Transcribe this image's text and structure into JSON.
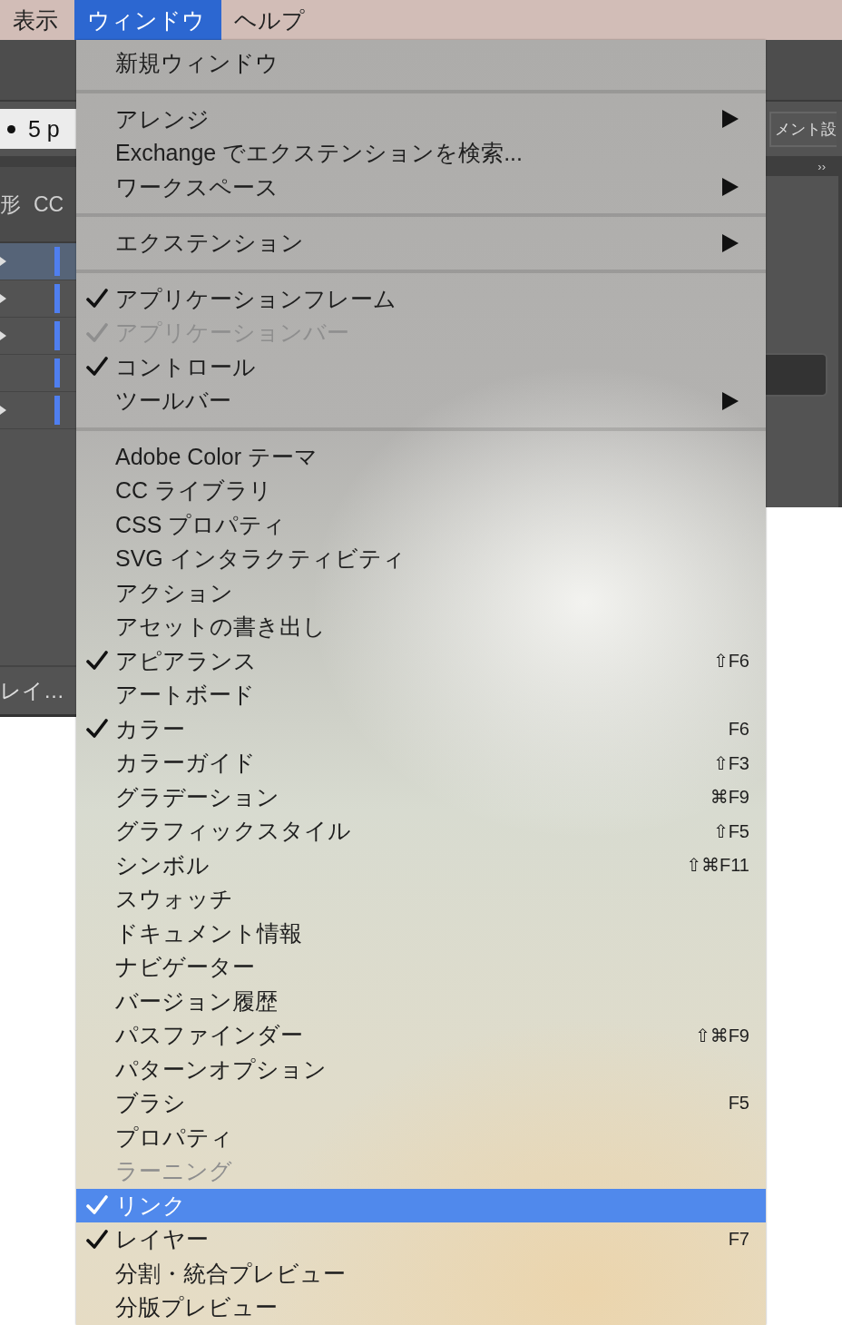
{
  "menu_bar": {
    "items": [
      {
        "label": "表示",
        "selected": false
      },
      {
        "label": "ウィンドウ",
        "selected": true
      },
      {
        "label": "ヘルプ",
        "selected": false
      }
    ]
  },
  "background": {
    "left_panel": {
      "size_field": "5 p",
      "tabs": [
        "形",
        "CC"
      ],
      "layer_rows": [
        {
          "selected": true,
          "expandable": true,
          "color": "#4f7ff0"
        },
        {
          "selected": false,
          "expandable": true,
          "color": "#4f7ff0"
        },
        {
          "selected": false,
          "expandable": true,
          "color": "#4f7ff0"
        },
        {
          "selected": false,
          "expandable": false,
          "color": "#4f7ff0"
        },
        {
          "selected": false,
          "expandable": true,
          "color": "#4f7ff0"
        }
      ],
      "footer": "レイ…"
    },
    "right_panel": {
      "button_label": "メント設",
      "collapse": "››"
    }
  },
  "menu": {
    "groups": [
      [
        {
          "label": "新規ウィンドウ",
          "checked": false,
          "disabled": false,
          "selected": false,
          "submenu": false
        }
      ],
      [
        {
          "label": "アレンジ",
          "checked": false,
          "disabled": false,
          "selected": false,
          "submenu": true
        },
        {
          "label": "Exchange でエクステンションを検索...",
          "checked": false,
          "disabled": false,
          "selected": false,
          "submenu": false
        },
        {
          "label": "ワークスペース",
          "checked": false,
          "disabled": false,
          "selected": false,
          "submenu": true
        }
      ],
      [
        {
          "label": "エクステンション",
          "checked": false,
          "disabled": false,
          "selected": false,
          "submenu": true
        }
      ],
      [
        {
          "label": "アプリケーションフレーム",
          "checked": true,
          "disabled": false,
          "selected": false,
          "submenu": false
        },
        {
          "label": "アプリケーションバー",
          "checked": true,
          "disabled": true,
          "selected": false,
          "submenu": false
        },
        {
          "label": "コントロール",
          "checked": true,
          "disabled": false,
          "selected": false,
          "submenu": false
        },
        {
          "label": "ツールバー",
          "checked": false,
          "disabled": false,
          "selected": false,
          "submenu": true
        }
      ],
      [
        {
          "label": "Adobe Color テーマ",
          "checked": false,
          "disabled": false,
          "selected": false,
          "submenu": false
        },
        {
          "label": "CC ライブラリ",
          "checked": false,
          "disabled": false,
          "selected": false,
          "submenu": false
        },
        {
          "label": "CSS プロパティ",
          "checked": false,
          "disabled": false,
          "selected": false,
          "submenu": false
        },
        {
          "label": "SVG インタラクティビティ",
          "checked": false,
          "disabled": false,
          "selected": false,
          "submenu": false
        },
        {
          "label": "アクション",
          "checked": false,
          "disabled": false,
          "selected": false,
          "submenu": false
        },
        {
          "label": "アセットの書き出し",
          "checked": false,
          "disabled": false,
          "selected": false,
          "submenu": false
        },
        {
          "label": "アピアランス",
          "checked": true,
          "disabled": false,
          "selected": false,
          "submenu": false,
          "shortcut": "⇧F6"
        },
        {
          "label": "アートボード",
          "checked": false,
          "disabled": false,
          "selected": false,
          "submenu": false
        },
        {
          "label": "カラー",
          "checked": true,
          "disabled": false,
          "selected": false,
          "submenu": false,
          "shortcut": "F6"
        },
        {
          "label": "カラーガイド",
          "checked": false,
          "disabled": false,
          "selected": false,
          "submenu": false,
          "shortcut": "⇧F3"
        },
        {
          "label": "グラデーション",
          "checked": false,
          "disabled": false,
          "selected": false,
          "submenu": false,
          "shortcut": "⌘F9"
        },
        {
          "label": "グラフィックスタイル",
          "checked": false,
          "disabled": false,
          "selected": false,
          "submenu": false,
          "shortcut": "⇧F5"
        },
        {
          "label": "シンボル",
          "checked": false,
          "disabled": false,
          "selected": false,
          "submenu": false,
          "shortcut": "⇧⌘F11"
        },
        {
          "label": "スウォッチ",
          "checked": false,
          "disabled": false,
          "selected": false,
          "submenu": false
        },
        {
          "label": "ドキュメント情報",
          "checked": false,
          "disabled": false,
          "selected": false,
          "submenu": false
        },
        {
          "label": "ナビゲーター",
          "checked": false,
          "disabled": false,
          "selected": false,
          "submenu": false
        },
        {
          "label": "バージョン履歴",
          "checked": false,
          "disabled": false,
          "selected": false,
          "submenu": false
        },
        {
          "label": "パスファインダー",
          "checked": false,
          "disabled": false,
          "selected": false,
          "submenu": false,
          "shortcut": "⇧⌘F9"
        },
        {
          "label": "パターンオプション",
          "checked": false,
          "disabled": false,
          "selected": false,
          "submenu": false
        },
        {
          "label": "ブラシ",
          "checked": false,
          "disabled": false,
          "selected": false,
          "submenu": false,
          "shortcut": "F5"
        },
        {
          "label": "プロパティ",
          "checked": false,
          "disabled": false,
          "selected": false,
          "submenu": false
        },
        {
          "label": "ラーニング",
          "checked": false,
          "disabled": true,
          "selected": false,
          "submenu": false
        },
        {
          "label": "リンク",
          "checked": true,
          "disabled": false,
          "selected": true,
          "submenu": false
        },
        {
          "label": "レイヤー",
          "checked": true,
          "disabled": false,
          "selected": false,
          "submenu": false,
          "shortcut": "F7"
        },
        {
          "label": "分割・統合プレビュー",
          "checked": false,
          "disabled": false,
          "selected": false,
          "submenu": false
        },
        {
          "label": "分版プレビュー",
          "checked": false,
          "disabled": false,
          "selected": false,
          "submenu": false
        }
      ]
    ]
  }
}
